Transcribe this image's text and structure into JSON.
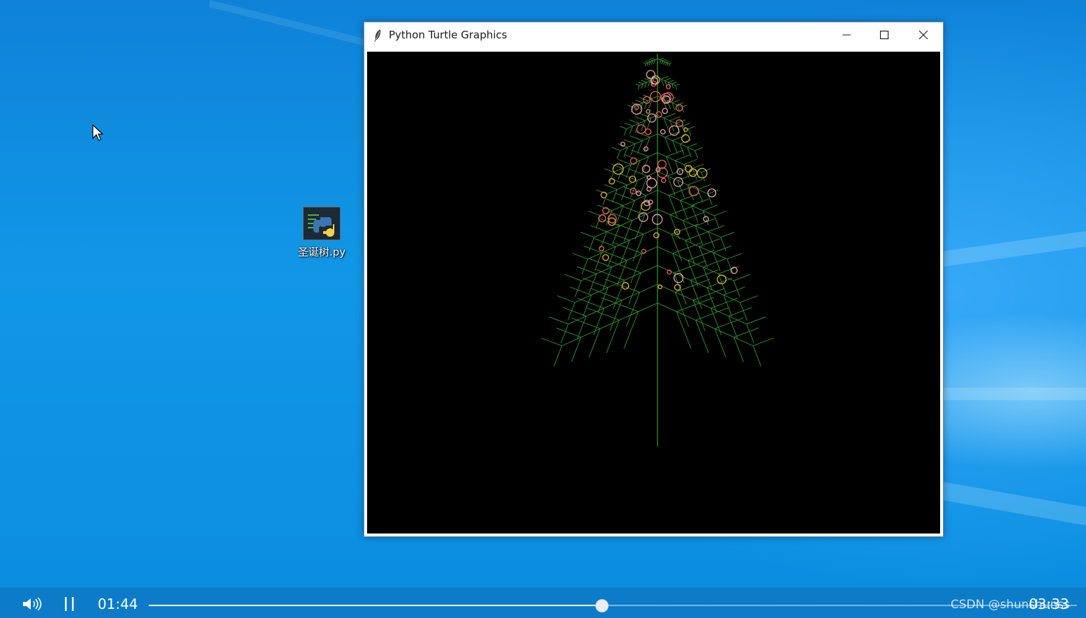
{
  "window": {
    "title": "Python Turtle Graphics",
    "minimize_glyph": "—",
    "maximize_glyph": "☐",
    "close_glyph": "✕",
    "canvas_background": "#000000",
    "tree_color": "#2c8a2c",
    "ornament_colors": [
      "#e8605a",
      "#e2b23a",
      "#f0a0b0"
    ]
  },
  "desktop": {
    "file_icon_label": "圣诞树.py",
    "background_color": "#1197e6"
  },
  "player": {
    "current_time": "01:44",
    "total_time": "03:33",
    "progress": 0.488,
    "watermark": "CSDN @shunshunss"
  },
  "icons": {
    "volume": "volume-icon",
    "pause": "pause-icon",
    "cursor": "mouse-cursor-icon",
    "feather": "tk-feather-icon",
    "python": "python-file-icon"
  }
}
